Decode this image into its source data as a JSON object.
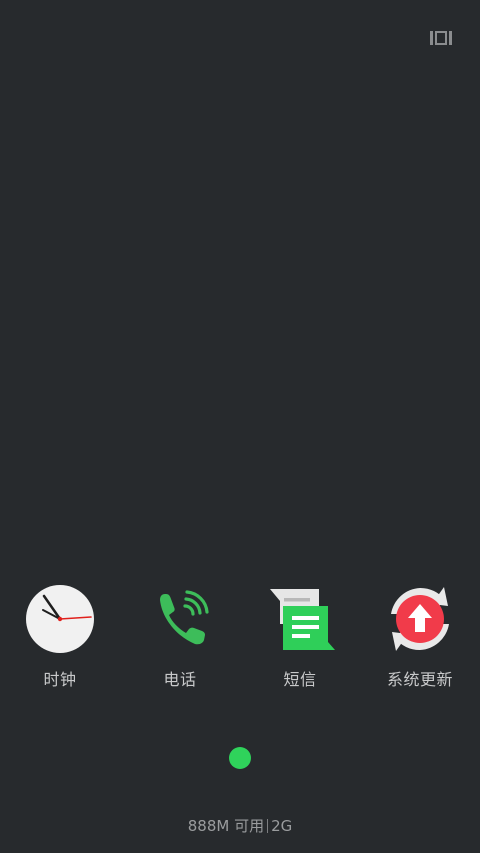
{
  "top_bar": {
    "icon": "recent-apps-icon"
  },
  "dock": {
    "apps": [
      {
        "label": "时钟",
        "icon": "clock-icon"
      },
      {
        "label": "电话",
        "icon": "phone-icon"
      },
      {
        "label": "短信",
        "icon": "message-icon"
      },
      {
        "label": "系统更新",
        "icon": "system-update-icon"
      }
    ]
  },
  "pager": {
    "dot_color": "#2fd35b"
  },
  "memory": {
    "available": "888M 可用",
    "total": "2G"
  }
}
